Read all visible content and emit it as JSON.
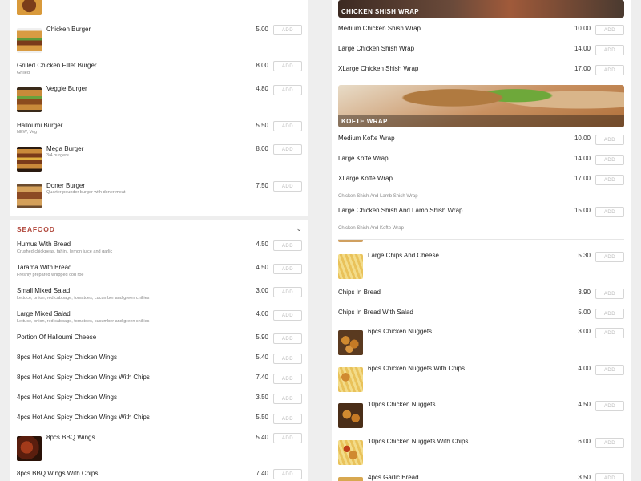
{
  "left_top": {
    "items": [
      {
        "name": "Chicken Burger",
        "desc": "",
        "price": "5.00",
        "add": "ADD",
        "icon": "burger-photo"
      },
      {
        "name": "Grilled Chicken Fillet Burger",
        "desc": "Grilled",
        "price": "8.00",
        "add": "ADD"
      },
      {
        "name": "Veggie Burger",
        "desc": "",
        "price": "4.80",
        "add": "ADD",
        "icon": "burger-photo"
      },
      {
        "name": "Halloumi Burger",
        "desc": "NEW, Veg",
        "price": "5.50",
        "add": "ADD"
      },
      {
        "name": "Mega Burger",
        "desc": "3/4 burgers",
        "price": "8.00",
        "add": "ADD",
        "icon": "burger-photo"
      },
      {
        "name": "Doner Burger",
        "desc": "Quarter pounder burger with doner meat",
        "price": "7.50",
        "add": "ADD",
        "icon": "burger-photo"
      }
    ]
  },
  "left_bottom": {
    "section_title": "SEAFOOD",
    "items": [
      {
        "name": "Humus With Bread",
        "desc": "Crushed chickpeas, tahini, lemon juice and garlic",
        "price": "4.50",
        "add": "ADD"
      },
      {
        "name": "Tarama With Bread",
        "desc": "Freshly prepared whipped cod roe",
        "price": "4.50",
        "add": "ADD"
      },
      {
        "name": "Small Mixed Salad",
        "desc": "Lettuce, onion, red cabbage, tomatoes, cucumber and green chillies",
        "price": "3.00",
        "add": "ADD"
      },
      {
        "name": "Large Mixed Salad",
        "desc": "Lettuce, onion, red cabbage, tomatoes, cucumber and green chillies",
        "price": "4.00",
        "add": "ADD"
      },
      {
        "name": "Portion Of Halloumi Cheese",
        "desc": "",
        "price": "5.90",
        "add": "ADD"
      },
      {
        "name": "8pcs Hot And Spicy Chicken Wings",
        "desc": "",
        "price": "5.40",
        "add": "ADD"
      },
      {
        "name": "8pcs Hot And Spicy Chicken Wings With Chips",
        "desc": "",
        "price": "7.40",
        "add": "ADD"
      },
      {
        "name": "4pcs Hot And Spicy Chicken Wings",
        "desc": "",
        "price": "3.50",
        "add": "ADD"
      },
      {
        "name": "4pcs Hot And Spicy Chicken Wings With Chips",
        "desc": "",
        "price": "5.50",
        "add": "ADD"
      },
      {
        "name": "8pcs BBQ Wings",
        "desc": "",
        "price": "5.40",
        "add": "ADD",
        "icon": "wings-photo"
      },
      {
        "name": "8pcs BBQ Wings With Chips",
        "desc": "",
        "price": "7.40",
        "add": "ADD"
      }
    ]
  },
  "right_top": {
    "banner1_title": "CHICKEN SHISH WRAP",
    "shish_items": [
      {
        "name": "Medium Chicken Shish Wrap",
        "price": "10.00",
        "add": "ADD"
      },
      {
        "name": "Large Chicken Shish Wrap",
        "price": "14.00",
        "add": "ADD"
      },
      {
        "name": "XLarge Chicken Shish Wrap",
        "price": "17.00",
        "add": "ADD"
      }
    ],
    "banner2_title": "KOFTE WRAP",
    "kofte_items": [
      {
        "name": "Medium Kofte Wrap",
        "price": "10.00",
        "add": "ADD"
      },
      {
        "name": "Large Kofte Wrap",
        "price": "14.00",
        "add": "ADD"
      },
      {
        "name": "XLarge Kofte Wrap",
        "price": "17.00",
        "add": "ADD"
      }
    ],
    "lamb_cat": "Chicken Shish And Lamb Shish Wrap",
    "lamb_item": {
      "name": "Large Chicken Shish And Lamb Shish Wrap",
      "price": "15.00",
      "add": "ADD"
    },
    "kofte_cat": "Chicken Shish And Kofte Wrap"
  },
  "right_bottom": {
    "items": [
      {
        "name": "Large Chips And Cheese",
        "price": "5.30",
        "add": "ADD",
        "icon": "chips-photo"
      },
      {
        "name": "Chips In Bread",
        "price": "3.90",
        "add": "ADD"
      },
      {
        "name": "Chips In Bread With Salad",
        "price": "5.00",
        "add": "ADD"
      },
      {
        "name": "6pcs Chicken Nuggets",
        "price": "3.00",
        "add": "ADD",
        "icon": "nuggets-photo"
      },
      {
        "name": "6pcs Chicken Nuggets With Chips",
        "price": "4.00",
        "add": "ADD",
        "icon": "nuggets-photo"
      },
      {
        "name": "10pcs Chicken Nuggets",
        "price": "4.50",
        "add": "ADD",
        "icon": "nuggets-photo"
      },
      {
        "name": "10pcs Chicken Nuggets With Chips",
        "price": "6.00",
        "add": "ADD",
        "icon": "nuggets-photo"
      },
      {
        "name": "4pcs Garlic Bread",
        "price": "3.50",
        "add": "ADD"
      }
    ]
  }
}
